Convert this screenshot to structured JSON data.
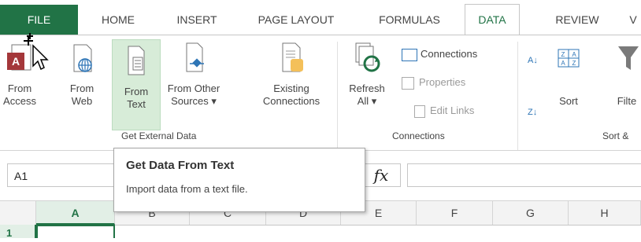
{
  "ribbon_tabs": [
    {
      "label": "FILE"
    },
    {
      "label": "HOME"
    },
    {
      "label": "INSERT"
    },
    {
      "label": "PAGE LAYOUT"
    },
    {
      "label": "FORMULAS"
    },
    {
      "label": "DATA"
    },
    {
      "label": "REVIEW"
    },
    {
      "label": "V"
    }
  ],
  "active_tab": "DATA",
  "get_external_data": {
    "group_label": "Get External Data",
    "from_access": {
      "line1": "From",
      "line2": "Access"
    },
    "from_web": {
      "line1": "From",
      "line2": "Web"
    },
    "from_text": {
      "line1": "From",
      "line2": "Text"
    },
    "from_other": {
      "line1": "From Other",
      "line2": "Sources ▾"
    },
    "existing": {
      "line1": "Existing",
      "line2": "Connections"
    }
  },
  "connections": {
    "group_label": "Connections",
    "refresh_all": {
      "line1": "Refresh",
      "line2": "All ▾"
    },
    "connections_label": "Connections",
    "properties_label": "Properties",
    "edit_links_label": "Edit Links"
  },
  "sort_filter": {
    "group_label": "Sort &",
    "sort_label": "Sort",
    "filter_label": "Filte",
    "az_icon_text": "A↓",
    "za_icon_text": "Z↓"
  },
  "formula_bar": {
    "name_box": "A1",
    "fx_label": "fx"
  },
  "columns": [
    "A",
    "B",
    "C",
    "D",
    "E",
    "F",
    "G",
    "H"
  ],
  "rows": [
    "1"
  ],
  "tooltip": {
    "title": "Get Data From Text",
    "description": "Import data from a text file."
  },
  "colors": {
    "excel_green": "#217346",
    "highlight": "#d7ecd8"
  }
}
